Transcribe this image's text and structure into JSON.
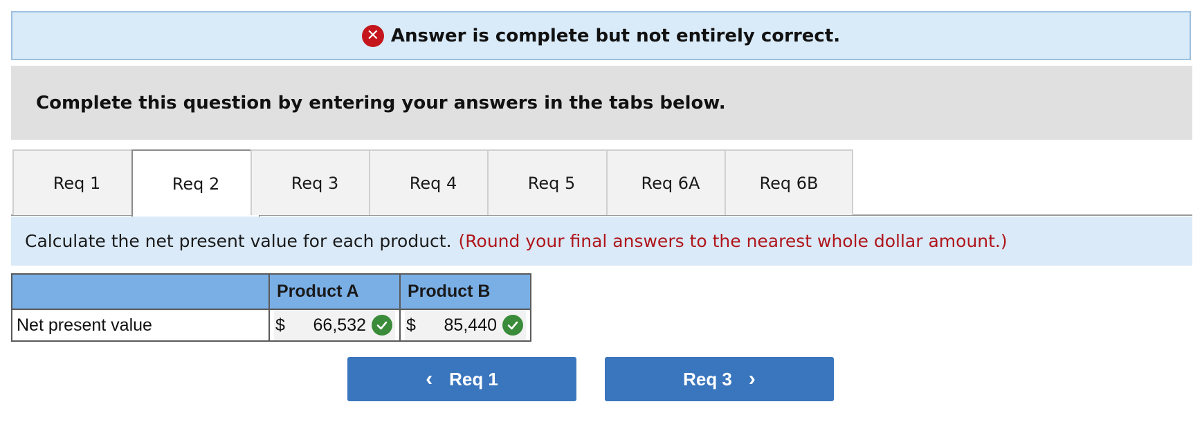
{
  "banner": {
    "icon": "error-x-icon",
    "message": "Answer is complete but not entirely correct.",
    "icon_color": "#c4161c"
  },
  "instructions": "Complete this question by entering your answers in the tabs below.",
  "tabs": [
    {
      "label": "Req 1",
      "active": false
    },
    {
      "label": "Req 2",
      "active": true
    },
    {
      "label": "Req 3",
      "active": false
    },
    {
      "label": "Req 4",
      "active": false
    },
    {
      "label": "Req 5",
      "active": false
    },
    {
      "label": "Req 6A",
      "active": false
    },
    {
      "label": "Req 6B",
      "active": false
    }
  ],
  "prompt": {
    "text": "Calculate the net present value for each product.",
    "hint": "(Round your final answers to the nearest whole dollar amount.)"
  },
  "table": {
    "headers": [
      "",
      "Product A",
      "Product B"
    ],
    "row_label": "Net present value",
    "currency": "$",
    "values": [
      "66,532",
      "85,440"
    ],
    "status": [
      "correct-check-icon",
      "correct-check-icon"
    ]
  },
  "nav": {
    "prev_label": "Req 1",
    "next_label": "Req 3"
  },
  "colors": {
    "accent": "#3a76bd",
    "header_bg": "#7aafe6",
    "correct": "#3a8b3a"
  }
}
